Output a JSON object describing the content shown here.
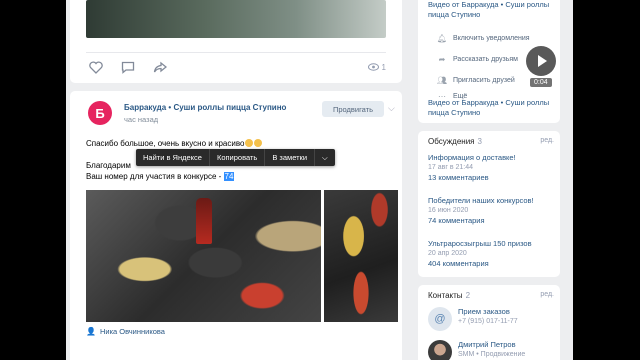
{
  "post_top": {
    "views": "1"
  },
  "post": {
    "avatar_letter": "Б",
    "author": "Барракуда • Суши роллы пицца Ступино",
    "time": "час назад",
    "subscribe_label": "Продвигать",
    "line1": "Спасибо большое, очень вкусно и красиво",
    "line2": "Благодарим",
    "line3_prefix": "Ваш номер для участия в конкурсе - ",
    "line3_number": "74",
    "photo_author": "Ника Овчинникова",
    "context_menu": [
      "Найти в Яндексе",
      "Копировать",
      "В заметки"
    ]
  },
  "video": {
    "title_top": "Видео от Барракуда • Суши роллы пицца Ступино",
    "menu": [
      "Включить уведомления",
      "Рассказать друзьям",
      "Пригласить друзей",
      "Ещё"
    ],
    "duration": "0:04",
    "title_bottom": "Видео от Барракуда • Суши роллы пицца Ступино"
  },
  "discussions": {
    "title": "Обсуждения",
    "count": "3",
    "edit": "ред.",
    "items": [
      {
        "title": "Информация о доставке!",
        "date": "17 авг в 21:44",
        "comments": "13 комментариев"
      },
      {
        "title": "Победители наших конкурсов!",
        "date": "16 июн 2020",
        "comments": "74 комментария"
      },
      {
        "title": "Ультраросзыгрыш 150 призов",
        "date": "20 апр 2020",
        "comments": "404 комментария"
      }
    ]
  },
  "contacts": {
    "title": "Контакты",
    "count": "2",
    "edit": "ред.",
    "items": [
      {
        "name": "Прием заказов",
        "info": "+7 (915) 017-11-77"
      },
      {
        "name": "Дмитрий Петров",
        "info": "SMM • Продвижение"
      }
    ]
  },
  "colors": {
    "link": "#2a5885",
    "accent": "#e6245f",
    "selection": "#3390ff",
    "background": "#edeef0"
  }
}
